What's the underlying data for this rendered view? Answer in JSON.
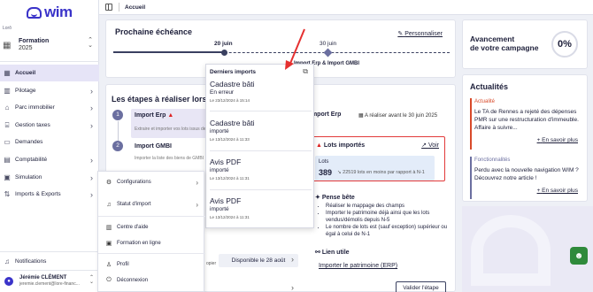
{
  "brand": {
    "name": "wim"
  },
  "sidebar": {
    "org_label": "Lorô",
    "org_name": "Formation",
    "org_year": "2025",
    "items": [
      {
        "label": "Accueil"
      },
      {
        "label": "Pilotage"
      },
      {
        "label": "Parc immobilier"
      },
      {
        "label": "Gestion taxes"
      },
      {
        "label": "Demandes"
      },
      {
        "label": "Comptabilité"
      },
      {
        "label": "Simulation"
      },
      {
        "label": "Imports & Exports"
      }
    ],
    "notifications": "Notifications",
    "user_name": "Jérémie CLÉMENT",
    "user_email": "jeremie.clement@lore-financ..."
  },
  "topbar": {
    "breadcrumb": "Accueil"
  },
  "echeance": {
    "title": "Prochaine échéance",
    "personnaliser": "Personnaliser",
    "date1": "20 juin",
    "date2": "30 juin",
    "event2": "Import Erp & Import GMBI"
  },
  "avancement": {
    "title_line1": "Avancement",
    "title_line2": "de votre campagne",
    "percent": "0%"
  },
  "etapes": {
    "title": "Les étapes à réaliser lors de",
    "steps": [
      {
        "num": "1",
        "name": "Import Erp",
        "desc": "Extraire et importer vos lots issus de votre"
      },
      {
        "num": "2",
        "name": "Import GMBI",
        "desc": "Importer la liste des biens de GMBI"
      }
    ],
    "disponible": "Disponible le 28 août",
    "copier": "opier"
  },
  "detail": {
    "title": "Import Erp",
    "deadline": "A réaliser avant le 30 juin 2025",
    "lots_title": "Lots importés",
    "voir": "Voir",
    "lots_label": "Lots",
    "lots_count": "389",
    "lots_delta": "22519 lots en moins par rapport à N-1",
    "pense_bete": "Pense bête",
    "tips": [
      "Réaliser le mappage des champs",
      "Importer le patrimoine déjà ainsi que les lots vendus/démolis depuis N-5",
      "Le nombre de lots est (sauf exception) supérieur ou égal à celui de N-1"
    ],
    "lien_utile": "Lien utile",
    "lien": "Importer le patrimoine (ERP)",
    "valider": "Valider l'étape"
  },
  "imports_popup": {
    "title": "Derniers imports",
    "items": [
      {
        "name": "Cadastre bâti",
        "status": "En erreur",
        "date": "Le 23/12/2024 à 15:14"
      },
      {
        "name": "Cadastre bâti",
        "status": "importé",
        "date": "Le 13/12/2024 à 11:33"
      },
      {
        "name": "Avis PDF",
        "status": "importé",
        "date": "Le 13/12/2024 à 11:31"
      },
      {
        "name": "Avis PDF",
        "status": "importé",
        "date": "Le 13/12/2024 à 11:31"
      }
    ]
  },
  "actualites": {
    "title": "Actualités",
    "items": [
      {
        "tag": "Actualité",
        "text": "Le TA de Rennes a rejeté des dépenses PMR sur une restructuration d'immeuble. Affaire à suivre...",
        "more": "En savoir plus"
      },
      {
        "tag": "Fonctionnalités",
        "text": "Perdu avec la nouvelle navigation WIM ? Découvrez notre article !",
        "more": "En savoir plus"
      }
    ]
  },
  "user_menu": {
    "items": [
      {
        "label": "Configurations"
      },
      {
        "label": "Statut d'import"
      },
      {
        "label": "Centre d'aide"
      },
      {
        "label": "Formation en ligne"
      },
      {
        "label": "Profil"
      },
      {
        "label": "Déconnexion"
      }
    ]
  }
}
